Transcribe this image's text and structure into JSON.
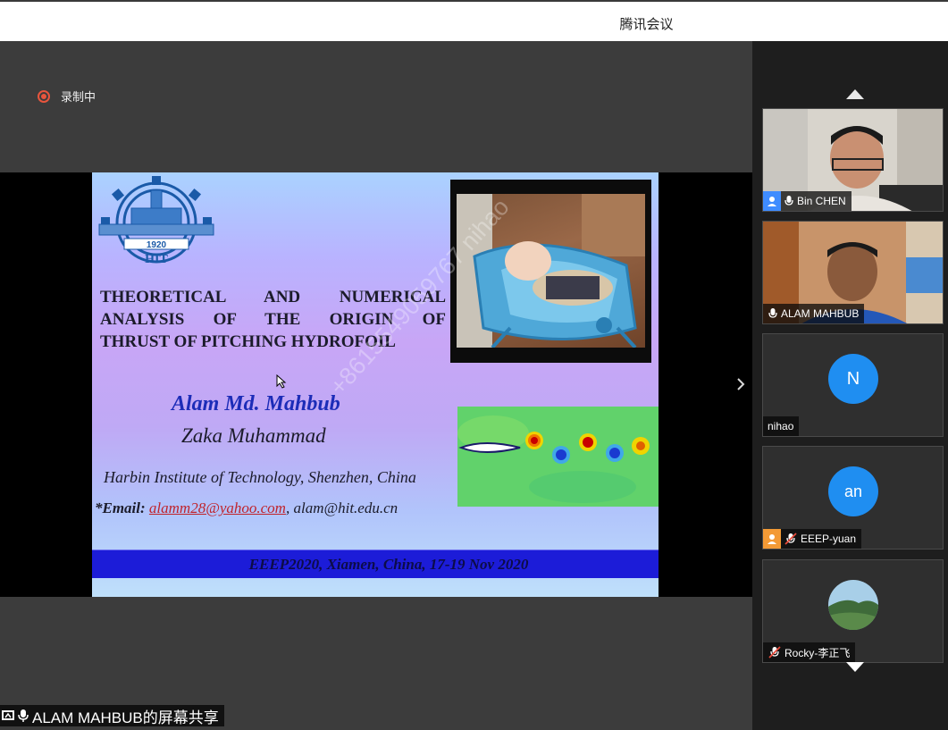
{
  "window": {
    "title": "腾讯会议"
  },
  "recording": {
    "label": "录制中"
  },
  "slide": {
    "title_lines": [
      "THEORETICAL AND NUMERICAL",
      "ANALYSIS OF THE ORIGIN OF",
      "THRUST OF PITCHING HYDROFOIL"
    ],
    "author1": "Alam Md. Mahbub",
    "author2": "Zaka Muhammad",
    "institution": "Harbin Institute of Technology, Shenzhen, China",
    "email_label": "*Email:",
    "email1": "alamm28@yahoo.com",
    "email_sep": ",",
    "email2": "alam@hit.edu.cn",
    "footer": "EEEP2020, Xiamen, China, 17-19 Nov 2020",
    "logo_text": "HIT",
    "logo_year": "1920"
  },
  "watermark": "+8615549059767 nihao",
  "share_label": "ALAM MAHBUB的屏幕共享",
  "participants": [
    {
      "name": "Bin CHEN",
      "type": "video",
      "badge": "user",
      "mic": "on"
    },
    {
      "name": "ALAM MAHBUB",
      "type": "video",
      "badge": "none",
      "mic": "on"
    },
    {
      "name": "nihao",
      "type": "avatar",
      "avatar_text": "N",
      "badge": "none",
      "mic": "none"
    },
    {
      "name": "EEEP-yuan",
      "type": "avatar",
      "avatar_text": "an",
      "badge": "orange-user",
      "mic": "muted"
    },
    {
      "name": "Rocky-李正飞",
      "type": "photo",
      "badge": "none",
      "mic": "muted"
    }
  ],
  "colors": {
    "accent": "#1f8ef1",
    "recording": "#e8553d",
    "slide_footer": "#1c1cd8",
    "author_blue": "#1c2cb8",
    "email_red": "#c0232b"
  }
}
